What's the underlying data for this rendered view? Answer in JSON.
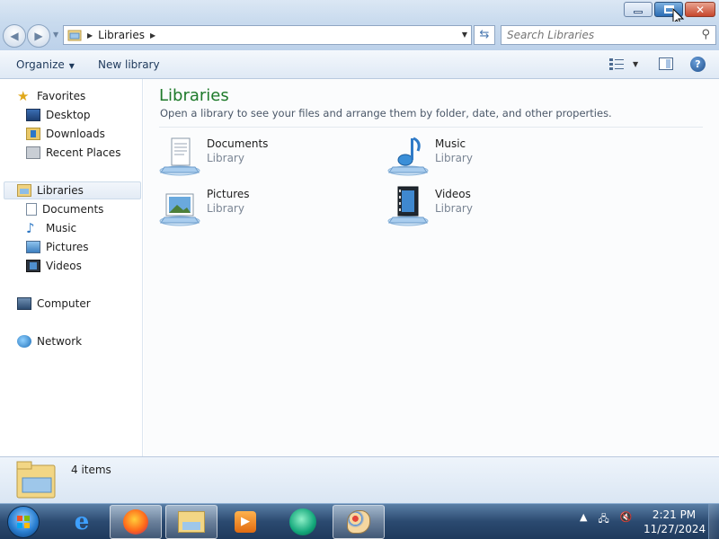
{
  "window": {
    "buttons": {
      "minimize": "minimize",
      "maximize": "restore",
      "close": "close"
    }
  },
  "address": {
    "crumbs": [
      "Libraries"
    ],
    "search_placeholder": "Search Libraries"
  },
  "toolbar": {
    "organize_label": "Organize",
    "new_library_label": "New library"
  },
  "nav": {
    "favorites": {
      "label": "Favorites",
      "items": [
        "Desktop",
        "Downloads",
        "Recent Places"
      ]
    },
    "libraries": {
      "label": "Libraries",
      "items": [
        "Documents",
        "Music",
        "Pictures",
        "Videos"
      ]
    },
    "computer": "Computer",
    "network": "Network"
  },
  "content": {
    "title": "Libraries",
    "description": "Open a library to see your files and arrange them by folder, date, and other properties.",
    "libraries": [
      {
        "name": "Documents",
        "kind": "Library",
        "icon": "documents-library-icon"
      },
      {
        "name": "Music",
        "kind": "Library",
        "icon": "music-library-icon"
      },
      {
        "name": "Pictures",
        "kind": "Library",
        "icon": "pictures-library-icon"
      },
      {
        "name": "Videos",
        "kind": "Library",
        "icon": "videos-library-icon"
      }
    ]
  },
  "details": {
    "count": "4 items"
  },
  "taskbar": {
    "apps": [
      "internet-explorer-icon",
      "firefox-icon",
      "windows-explorer-icon",
      "media-player-icon",
      "green-app-icon",
      "paint-icon"
    ],
    "time": "2:21 PM",
    "date": "11/27/2024"
  },
  "colors": {
    "title_green": "#1e7a2a",
    "link_blue": "#1e395b",
    "close_red": "#c6462c"
  }
}
